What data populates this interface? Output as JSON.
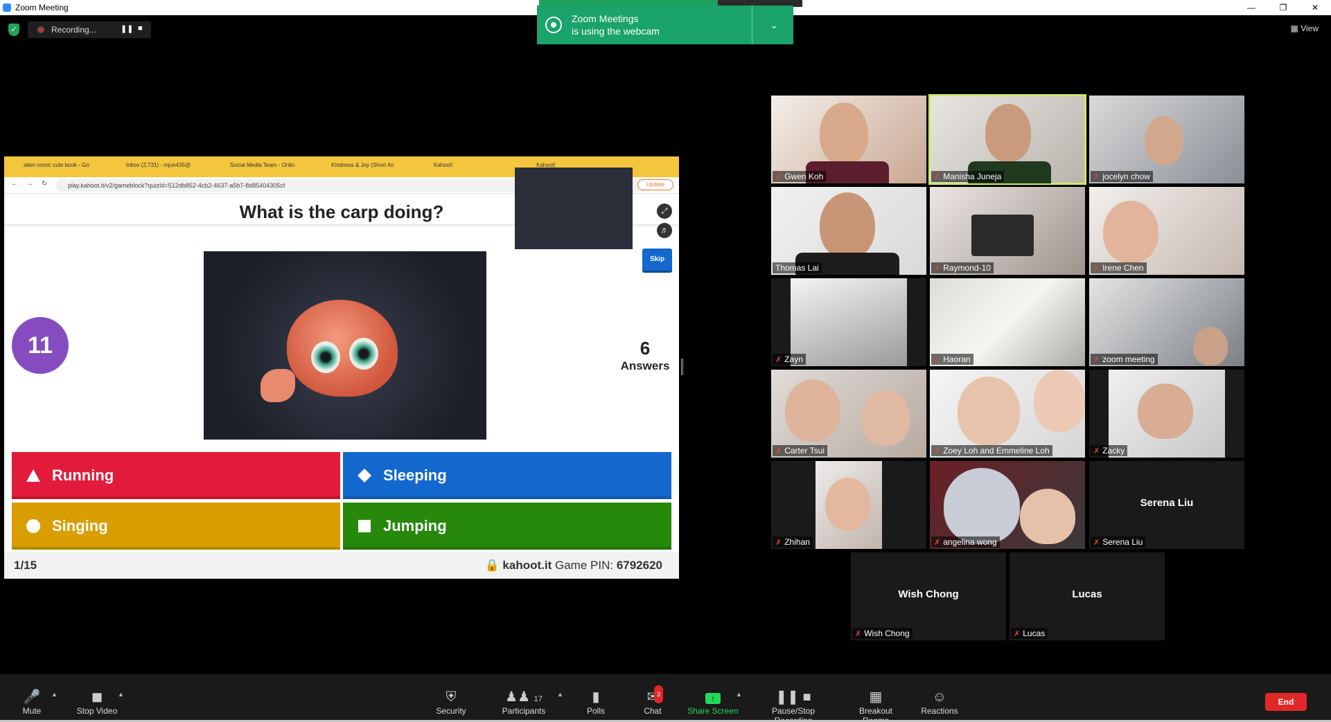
{
  "window": {
    "title": "Zoom Meeting"
  },
  "recording": {
    "label": "Recording..."
  },
  "view_label": "View",
  "notification": {
    "line1": "Zoom Meetings",
    "line2": "is using the webcam"
  },
  "browser": {
    "tabs": [
      "alien comic cute book - Go",
      "Inbox (2,731) - mjun435@",
      "Social Media Team - Onlin",
      "Kindness & Joy (Short An",
      "Kahoot!",
      "Kahoot!"
    ],
    "url": "play.kahoot.it/v2/gameblock?quizId=512db852-4cb2-4637-a5b7-8d85404305cf",
    "update_label": "Update"
  },
  "kahoot": {
    "question": "What is the carp doing?",
    "timer": "11",
    "answers_count": "6",
    "answers_label": "Answers",
    "skip_label": "Skip",
    "options": [
      {
        "label": "Running",
        "shape": "triangle",
        "color": "#e21b3c"
      },
      {
        "label": "Sleeping",
        "shape": "diamond",
        "color": "#1368ce"
      },
      {
        "label": "Singing",
        "shape": "circle",
        "color": "#d89e00"
      },
      {
        "label": "Jumping",
        "shape": "square",
        "color": "#26890c"
      }
    ],
    "progress": "1/15",
    "site": "kahoot.it",
    "pin_label": "Game PIN:",
    "pin": "6792620"
  },
  "participants": [
    {
      "name": "Gwen Koh",
      "muted": true,
      "video": true
    },
    {
      "name": "Manisha Juneja",
      "muted": true,
      "video": true,
      "active": true
    },
    {
      "name": "jocelyn chow",
      "muted": true,
      "video": true
    },
    {
      "name": "Thomas Lai",
      "muted": false,
      "video": true
    },
    {
      "name": "Raymond-10",
      "muted": true,
      "video": true
    },
    {
      "name": "Irene Chen",
      "muted": true,
      "video": true
    },
    {
      "name": "Zayn",
      "muted": true,
      "video": true
    },
    {
      "name": "Haoran",
      "muted": true,
      "video": true
    },
    {
      "name": "zoom meeting",
      "muted": true,
      "video": true
    },
    {
      "name": "Carter Tsui",
      "muted": true,
      "video": true
    },
    {
      "name": "Zoey Loh and Emmeline Loh",
      "muted": true,
      "video": true
    },
    {
      "name": "Zacky",
      "muted": true,
      "video": true
    },
    {
      "name": "Zhihan",
      "muted": true,
      "video": true
    },
    {
      "name": "angelina wong",
      "muted": true,
      "video": true
    },
    {
      "name": "Serena Liu",
      "muted": true,
      "video": false
    },
    {
      "name": "Wish Chong",
      "muted": true,
      "video": false
    },
    {
      "name": "Lucas",
      "muted": true,
      "video": false
    }
  ],
  "toolbar": {
    "mute": "Mute",
    "stop_video": "Stop Video",
    "security": "Security",
    "participants": "Participants",
    "participants_count": "17",
    "polls": "Polls",
    "chat": "Chat",
    "chat_badge": "3",
    "share_screen": "Share Screen",
    "pause_stop_recording": "Pause/Stop Recording",
    "breakout_rooms": "Breakout Rooms",
    "reactions": "Reactions",
    "end": "End"
  },
  "colors": {
    "share_green": "#23d959",
    "end_red": "#e02828",
    "active_speaker": "#cfe86a"
  }
}
